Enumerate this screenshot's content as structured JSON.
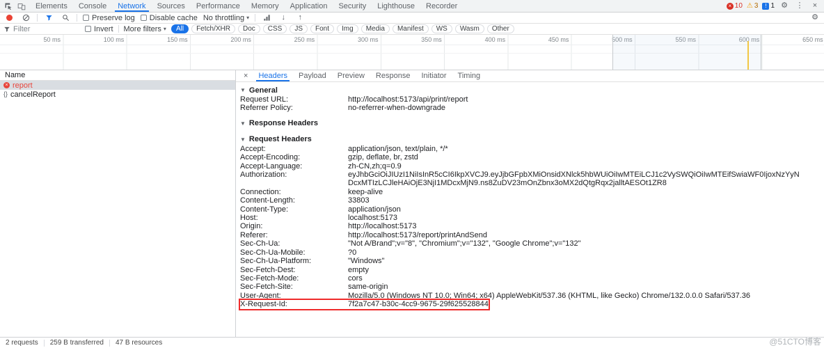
{
  "glyphs": {
    "x": "×",
    "caret_down": "▾",
    "triangle_down": "▼",
    "braces": "{}",
    "warning": "⚠",
    "gear": "⚙",
    "kebab": "⋮",
    "arrow_down": "↓",
    "arrow_up": "↑"
  },
  "colors": {
    "accent_blue": "#1a73e8",
    "error_red": "#d93025",
    "warning_yellow": "#f29900",
    "annotation_red": "#ef2b2b",
    "timeline_marker_yellow": "#f2c744"
  },
  "main_tabs": {
    "items": [
      {
        "label": "Elements",
        "selected": false
      },
      {
        "label": "Console",
        "selected": false
      },
      {
        "label": "Network",
        "selected": true
      },
      {
        "label": "Sources",
        "selected": false
      },
      {
        "label": "Performance",
        "selected": false
      },
      {
        "label": "Memory",
        "selected": false
      },
      {
        "label": "Application",
        "selected": false
      },
      {
        "label": "Security",
        "selected": false
      },
      {
        "label": "Lighthouse",
        "selected": false
      },
      {
        "label": "Recorder",
        "selected": false
      }
    ],
    "error_count": "10",
    "warning_count": "3",
    "issue_count": "1"
  },
  "toolbar": {
    "preserve_log_label": "Preserve log",
    "disable_cache_label": "Disable cache",
    "throttling_value": "No throttling"
  },
  "filter_bar": {
    "filter_placeholder": "Filter",
    "invert_label": "Invert",
    "more_filters_label": "More filters",
    "chips": [
      {
        "label": "All",
        "selected": true
      },
      {
        "label": "Fetch/XHR",
        "selected": false
      },
      {
        "label": "Doc",
        "selected": false
      },
      {
        "label": "CSS",
        "selected": false
      },
      {
        "label": "JS",
        "selected": false
      },
      {
        "label": "Font",
        "selected": false
      },
      {
        "label": "Img",
        "selected": false
      },
      {
        "label": "Media",
        "selected": false
      },
      {
        "label": "Manifest",
        "selected": false
      },
      {
        "label": "WS",
        "selected": false
      },
      {
        "label": "Wasm",
        "selected": false
      },
      {
        "label": "Other",
        "selected": false
      }
    ]
  },
  "timeline": {
    "ticks": [
      "50 ms",
      "100 ms",
      "150 ms",
      "200 ms",
      "250 ms",
      "300 ms",
      "350 ms",
      "400 ms",
      "450 ms",
      "500 ms",
      "550 ms",
      "600 ms",
      "650 ms"
    ]
  },
  "request_list": {
    "name_header": "Name",
    "rows": [
      {
        "name": "report",
        "error": true,
        "selected": true
      },
      {
        "name": "cancelReport",
        "error": false,
        "selected": false
      }
    ]
  },
  "details": {
    "tabs": [
      {
        "label": "Headers",
        "selected": true
      },
      {
        "label": "Payload",
        "selected": false
      },
      {
        "label": "Preview",
        "selected": false
      },
      {
        "label": "Response",
        "selected": false
      },
      {
        "label": "Initiator",
        "selected": false
      },
      {
        "label": "Timing",
        "selected": false
      }
    ],
    "general": {
      "title": "General",
      "rows": [
        {
          "key": "Request URL:",
          "value": "http://localhost:5173/api/print/report",
          "annotated": false
        },
        {
          "key": "Referrer Policy:",
          "value": "no-referrer-when-downgrade",
          "annotated": false
        }
      ]
    },
    "response_headers": {
      "title": "Response Headers",
      "rows": []
    },
    "request_headers": {
      "title": "Request Headers",
      "rows": [
        {
          "key": "Accept:",
          "value": "application/json, text/plain, */*",
          "annotated": false
        },
        {
          "key": "Accept-Encoding:",
          "value": "gzip, deflate, br, zstd",
          "annotated": false
        },
        {
          "key": "Accept-Language:",
          "value": "zh-CN,zh;q=0.9",
          "annotated": false
        },
        {
          "key": "Authorization:",
          "value": "eyJhbGciOiJIUzI1NiIsInR5cCI6IkpXVCJ9.eyJjbGFpbXMiOnsidXNlck5hbWUiOiIwMTEiLCJ1c2VySWQiOiIwMTEifSwiaWF0IjoxNzYyNDcxMTIzLCJleHAiOjE3NjI1MDcxMjN9.ns8ZuDV23mOnZbnx3oMX2dQtgRqx2jalltAESOt1ZR8",
          "annotated": false
        },
        {
          "key": "Connection:",
          "value": "keep-alive",
          "annotated": false
        },
        {
          "key": "Content-Length:",
          "value": "33803",
          "annotated": false
        },
        {
          "key": "Content-Type:",
          "value": "application/json",
          "annotated": false
        },
        {
          "key": "Host:",
          "value": "localhost:5173",
          "annotated": false
        },
        {
          "key": "Origin:",
          "value": "http://localhost:5173",
          "annotated": false
        },
        {
          "key": "Referer:",
          "value": "http://localhost:5173/report/printAndSend",
          "annotated": false
        },
        {
          "key": "Sec-Ch-Ua:",
          "value": "\"Not A/Brand\";v=\"8\", \"Chromium\";v=\"132\", \"Google Chrome\";v=\"132\"",
          "annotated": false
        },
        {
          "key": "Sec-Ch-Ua-Mobile:",
          "value": "?0",
          "annotated": false
        },
        {
          "key": "Sec-Ch-Ua-Platform:",
          "value": "\"Windows\"",
          "annotated": false
        },
        {
          "key": "Sec-Fetch-Dest:",
          "value": "empty",
          "annotated": false
        },
        {
          "key": "Sec-Fetch-Mode:",
          "value": "cors",
          "annotated": false
        },
        {
          "key": "Sec-Fetch-Site:",
          "value": "same-origin",
          "annotated": false
        },
        {
          "key": "User-Agent:",
          "value": "Mozilla/5.0 (Windows NT 10.0; Win64; x64) AppleWebKit/537.36 (KHTML, like Gecko) Chrome/132.0.0.0 Safari/537.36",
          "annotated": false
        },
        {
          "key": "X-Request-Id:",
          "value": "7f2a7c47-b30c-4cc9-9675-29f625528844",
          "annotated": true
        }
      ]
    }
  },
  "status_bar": {
    "items": [
      "2 requests",
      "259 B transferred",
      "47 B resources"
    ]
  },
  "watermark": "@51CTO博客"
}
